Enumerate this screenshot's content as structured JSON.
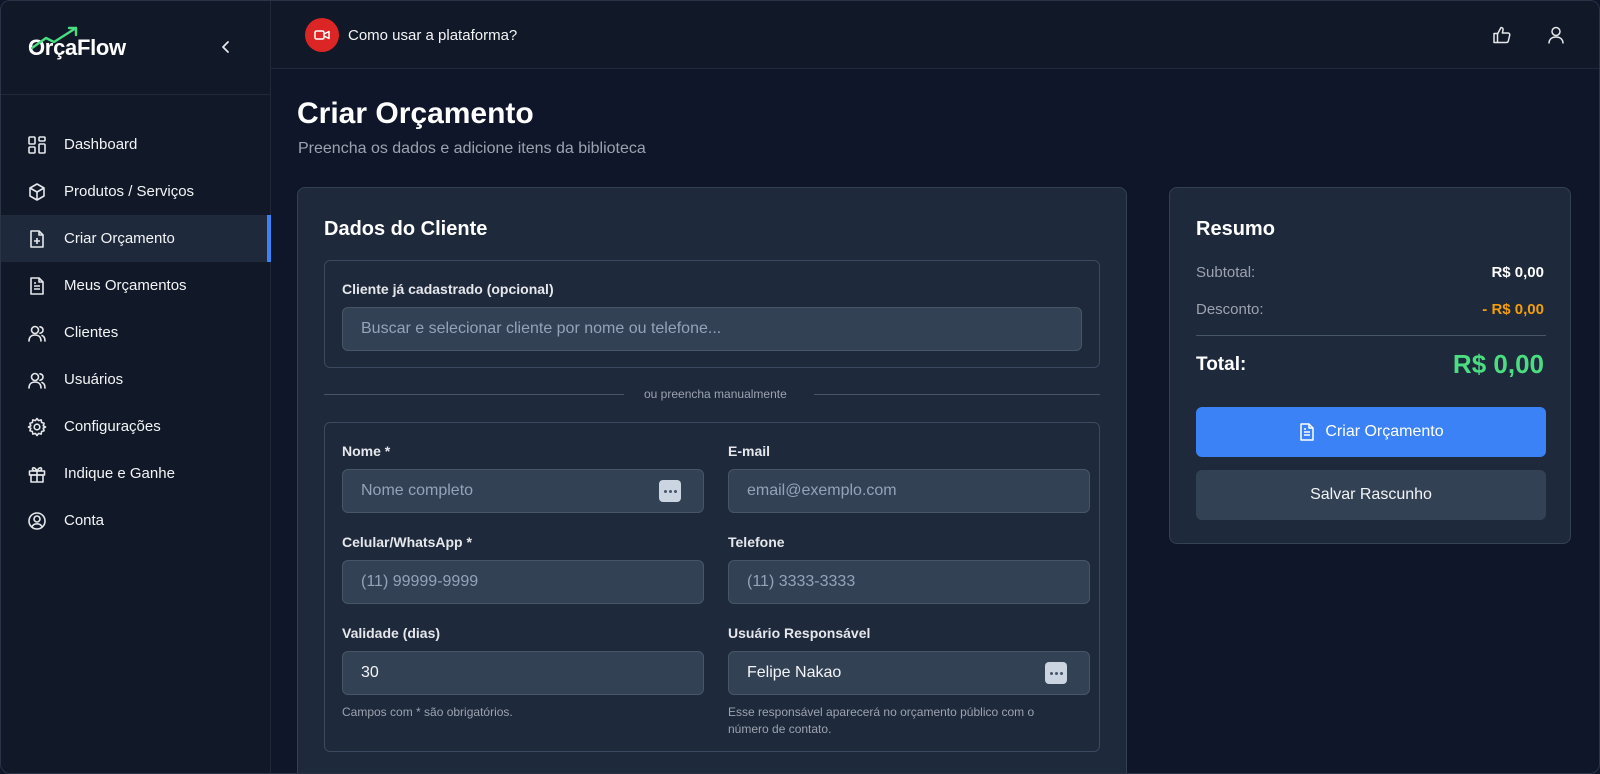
{
  "app": {
    "name": "OrçaFlow"
  },
  "sidebar": {
    "items": [
      {
        "label": "Dashboard",
        "icon": "dashboard-grid-icon"
      },
      {
        "label": "Produtos / Serviços",
        "icon": "box-icon"
      },
      {
        "label": "Criar Orçamento",
        "icon": "file-plus-icon",
        "active": true
      },
      {
        "label": "Meus Orçamentos",
        "icon": "file-text-icon"
      },
      {
        "label": "Clientes",
        "icon": "users-icon"
      },
      {
        "label": "Usuários",
        "icon": "users-icon"
      },
      {
        "label": "Configurações",
        "icon": "gear-icon"
      },
      {
        "label": "Indique e Ganhe",
        "icon": "gift-icon"
      },
      {
        "label": "Conta",
        "icon": "user-circle-icon"
      }
    ]
  },
  "topbar": {
    "help_text": "Como usar a plataforma?"
  },
  "page": {
    "title": "Criar Orçamento",
    "subtitle": "Preencha os dados e adicione itens da biblioteca"
  },
  "client_card": {
    "title": "Dados do Cliente",
    "existing_label": "Cliente já cadastrado (opcional)",
    "existing_placeholder": "Buscar e selecionar cliente por nome ou telefone...",
    "divider_text": "ou preencha manualmente",
    "fields": {
      "name": {
        "label": "Nome *",
        "placeholder": "Nome completo"
      },
      "email": {
        "label": "E-mail",
        "placeholder": "email@exemplo.com"
      },
      "cell": {
        "label": "Celular/WhatsApp *",
        "placeholder": "(11) 99999-9999"
      },
      "phone": {
        "label": "Telefone",
        "placeholder": "(11) 3333-3333"
      },
      "validity": {
        "label": "Validade (dias)",
        "value": "30"
      },
      "responsible": {
        "label": "Usuário Responsável",
        "value": "Felipe Nakao"
      }
    },
    "required_hint": "Campos com * são obrigatórios.",
    "responsible_hint_1": "Esse responsável aparecerá no orçamento público com o",
    "responsible_hint_2": "número de contato."
  },
  "summary": {
    "title": "Resumo",
    "subtotal_label": "Subtotal:",
    "subtotal_value": "R$ 0,00",
    "discount_label": "Desconto:",
    "discount_value": "- R$ 0,00",
    "total_label": "Total:",
    "total_value": "R$ 0,00",
    "create_button": "Criar Orçamento",
    "draft_button": "Salvar Rascunho"
  },
  "colors": {
    "accent": "#3b82f6",
    "total": "#4ade80",
    "discount": "#f59e0b",
    "help": "#dc2626"
  }
}
